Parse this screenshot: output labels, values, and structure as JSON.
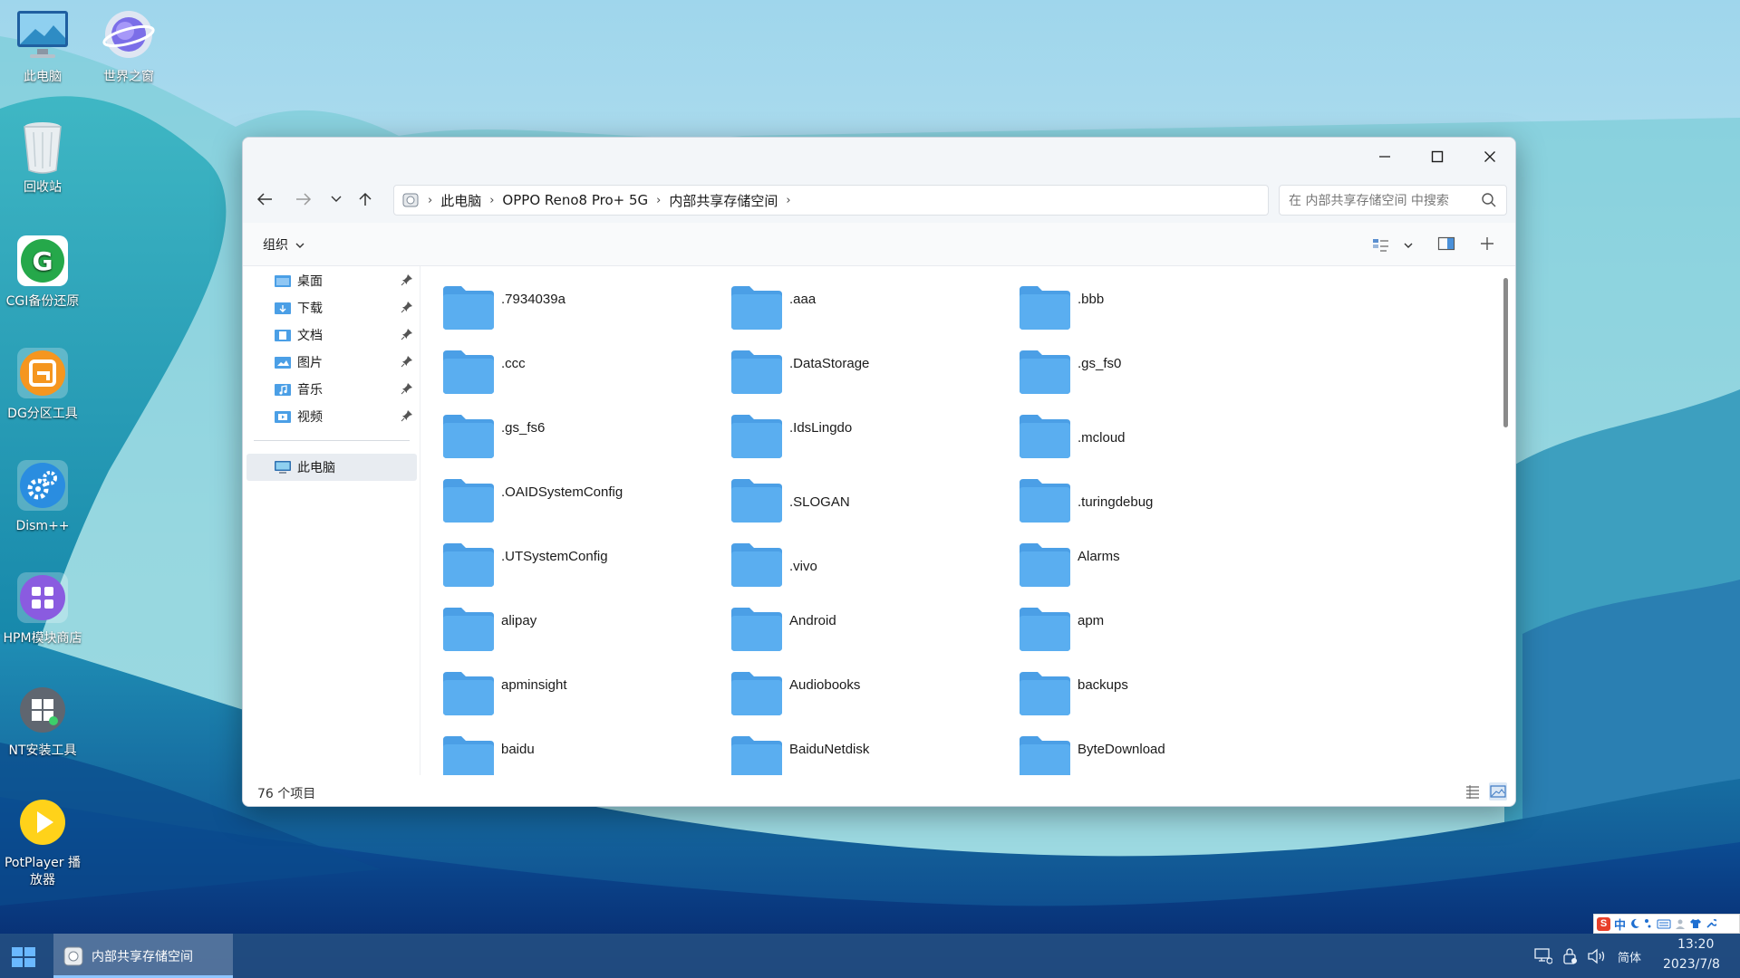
{
  "desktop": {
    "icons": [
      {
        "label": "此电脑",
        "icon": "computer-icon"
      },
      {
        "label": "世界之窗",
        "icon": "browser-icon"
      },
      {
        "label": "回收站",
        "icon": "recycle-bin-icon"
      },
      {
        "label": "CGI备份还原",
        "icon": "cgi-backup-icon"
      },
      {
        "label": "DG分区工具",
        "icon": "diskgenius-icon"
      },
      {
        "label": "Dism++",
        "icon": "gears-icon"
      },
      {
        "label": "HPM模块商店",
        "icon": "hpm-store-icon"
      },
      {
        "label": "NT安装工具",
        "icon": "nt-setup-icon"
      },
      {
        "label": "PotPlayer 播放器",
        "icon": "potplayer-icon"
      }
    ]
  },
  "window": {
    "title_buttons": {
      "minimize": "minimize-icon",
      "maximize": "maximize-icon",
      "close": "close-icon"
    },
    "breadcrumb": [
      "此电脑",
      "OPPO Reno8 Pro+ 5G",
      "内部共享存储空间"
    ],
    "search_placeholder": "在 内部共享存储空间 中搜索",
    "organize_label": "组织",
    "sidebar": {
      "quick_access": [
        {
          "label": "桌面",
          "pinned": true
        },
        {
          "label": "下载",
          "pinned": true
        },
        {
          "label": "文档",
          "pinned": true
        },
        {
          "label": "图片",
          "pinned": true
        },
        {
          "label": "音乐",
          "pinned": true
        },
        {
          "label": "视频",
          "pinned": true
        }
      ],
      "this_pc": "此电脑"
    },
    "folders": [
      ".7934039a",
      ".aaa",
      ".bbb",
      ".ccc",
      ".DataStorage",
      ".gs_fs0",
      ".gs_fs6",
      ".IdsLingdo",
      ".mcloud",
      ".OAIDSystemConfig",
      ".SLOGAN",
      ".turingdebug",
      ".UTSystemConfig",
      ".vivo",
      "Alarms",
      "alipay",
      "Android",
      "apm",
      "apminsight",
      "Audiobooks",
      "backups",
      "baidu",
      "BaiduNetdisk",
      "ByteDownload"
    ],
    "status": "76 个项目"
  },
  "taskbar": {
    "active_task": "内部共享存储空间",
    "ime_mode": "简体",
    "ime_lang": "中",
    "time": "13:20",
    "date": "2023/7/8"
  },
  "colors": {
    "folder": "#5aaef0",
    "folder_back": "#4b9fe6",
    "taskbar": "#265282"
  }
}
